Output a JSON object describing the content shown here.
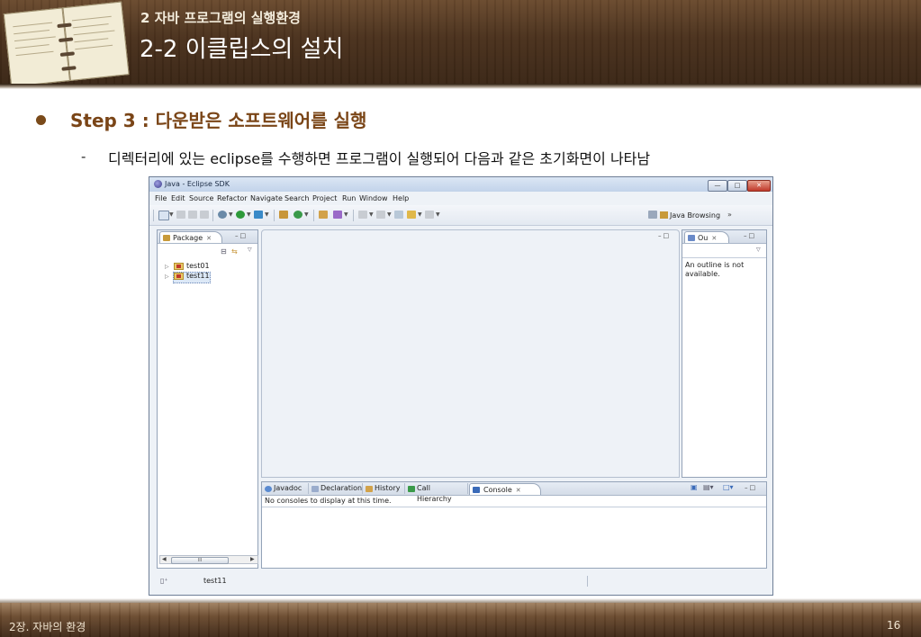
{
  "slide": {
    "chapter_number": "2",
    "chapter_title": "자바 프로그램의 실행환경",
    "section_title": "2-2 이클립스의 설치",
    "step_heading": "Step 3 : 다운받은 소프트웨어를 실행",
    "dash": "-",
    "description": "디렉터리에 있는 eclipse를 수행하면 프로그램이 실행되어 다음과 같은 초기화면이 나타남",
    "footer_left": "2장. 자바의 환경",
    "page_number": "16"
  },
  "eclipse": {
    "window_title": "Java - Eclipse SDK",
    "menu": [
      "File",
      "Edit",
      "Source",
      "Refactor",
      "Navigate",
      "Search",
      "Project",
      "Run",
      "Window",
      "Help"
    ],
    "perspective_label": "Java Browsing",
    "perspective_overflow": "»",
    "package_tab": "Package",
    "tree_items": [
      "test01",
      "test11"
    ],
    "outline_tab": "Ou",
    "outline_message": "An outline is not available.",
    "bottom_tabs": [
      "Javadoc",
      "Declaration",
      "History",
      "Call Hierarchy",
      "Console"
    ],
    "console_message": "No consoles to display at this time.",
    "status_text": "test11",
    "scroll_thumb": "III"
  },
  "colors": {
    "step_heading": "#7a4517",
    "wood_dark": "#3a2615",
    "eclipse_chrome": "#eef2f7"
  }
}
